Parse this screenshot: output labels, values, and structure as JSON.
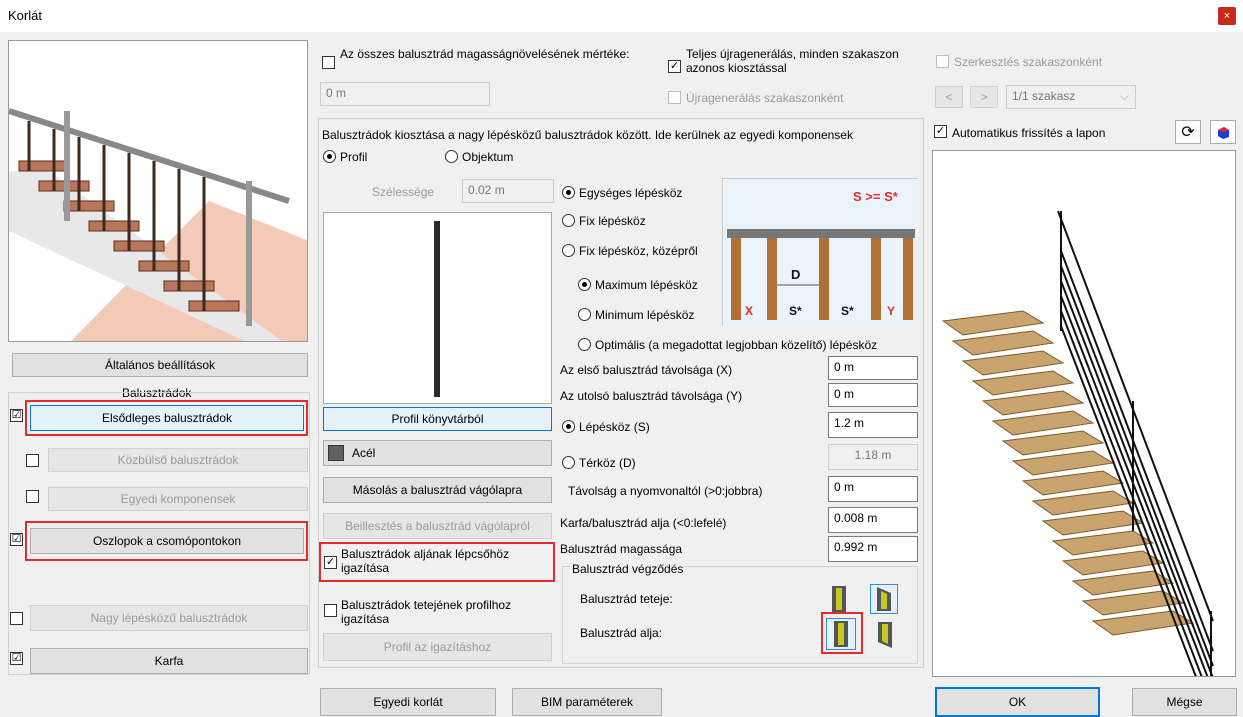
{
  "window": {
    "title": "Korlát",
    "close": "×"
  },
  "left": {
    "general_btn": "Általános beállítások",
    "group_label": "Balusztrádok",
    "items": [
      {
        "label": "Elsődleges balusztrádok",
        "checked": "☑"
      },
      {
        "label": "Közbülső balusztrádok",
        "checked": ""
      },
      {
        "label": "Egyedi komponensek",
        "checked": ""
      },
      {
        "label": "Oszlopok a csomópontokon",
        "checked": "☑"
      },
      {
        "label": "Nagy lépésközű balusztrádok",
        "checked": ""
      },
      {
        "label": "Karfa",
        "checked": "☑"
      }
    ]
  },
  "top": {
    "height_increase_label": "Az összes balusztrád magasságnövelésének mértéke:",
    "height_increase_value": "0 m",
    "full_regen_label": "Teljes újragenerálás, minden szakaszon azonos kiosztással",
    "regen_section_label": "Újragenerálás szakaszonként",
    "edit_section_label": "Szerkesztés szakaszonként",
    "nav_prev": "<",
    "nav_next": ">",
    "section_select": "1/1 szakasz",
    "auto_refresh_label": "Automatikus frissítés a lapon"
  },
  "middle": {
    "group_title": "Balusztrádok kiosztása a nagy lépésközű balusztrádok között. Ide kerülnek az egyedi komponensek",
    "profile_radio": "Profil",
    "object_radio": "Objektum",
    "width_label": "Szélessége",
    "width_value": "0.02 m",
    "profile_lib_btn": "Profil könyvtárból",
    "material_label": "Acél",
    "copy_btn": "Másolás a balusztrád vágólapra",
    "paste_btn": "Beillesztés a balusztrád vágólapról",
    "align_bottom_label": "Balusztrádok aljának lépcsőhöz igazítása",
    "align_top_label": "Balusztrádok tetejének profilhoz igazítása",
    "profile_align_btn": "Profil az igazításhoz"
  },
  "spacing": {
    "uniform": "Egységes lépésköz",
    "fixed": "Fix lépésköz",
    "fixed_center": "Fix lépésköz, középről",
    "maximum": "Maximum lépésköz",
    "minimum": "Minimum lépésköz",
    "optimal": "Optimális (a megadottat legjobban közelítő) lépésköz",
    "diagram_formula": "S >= S*",
    "diagram_d": "D",
    "diagram_x": "X",
    "diagram_s1": "S*",
    "diagram_s2": "S*",
    "diagram_y": "Y"
  },
  "params": {
    "first_dist_label": "Az első balusztrád távolsága (X)",
    "first_dist_value": "0 m",
    "last_dist_label": "Az utolsó balusztrád távolsága (Y)",
    "last_dist_value": "0 m",
    "step_label": "Lépésköz (S)",
    "step_value": "1.2 m",
    "gap_label": "Térköz (D)",
    "gap_value": "1.18 m",
    "path_dist_label": "Távolság a nyomvonaltól (>0:jobbra)",
    "path_dist_value": "0 m",
    "rail_bottom_label": "Karfa/balusztrád alja (<0:lefelé)",
    "rail_bottom_value": "0.008 m",
    "height_label": "Balusztrád magassága",
    "height_value": "0.992 m",
    "ending_title": "Balusztrád végződés",
    "top_label": "Balusztrád teteje:",
    "bottom_label": "Balusztrád alja:"
  },
  "footer": {
    "custom_btn": "Egyedi korlát",
    "bim_btn": "BIM paraméterek",
    "ok_btn": "OK",
    "cancel_btn": "Mégse"
  }
}
